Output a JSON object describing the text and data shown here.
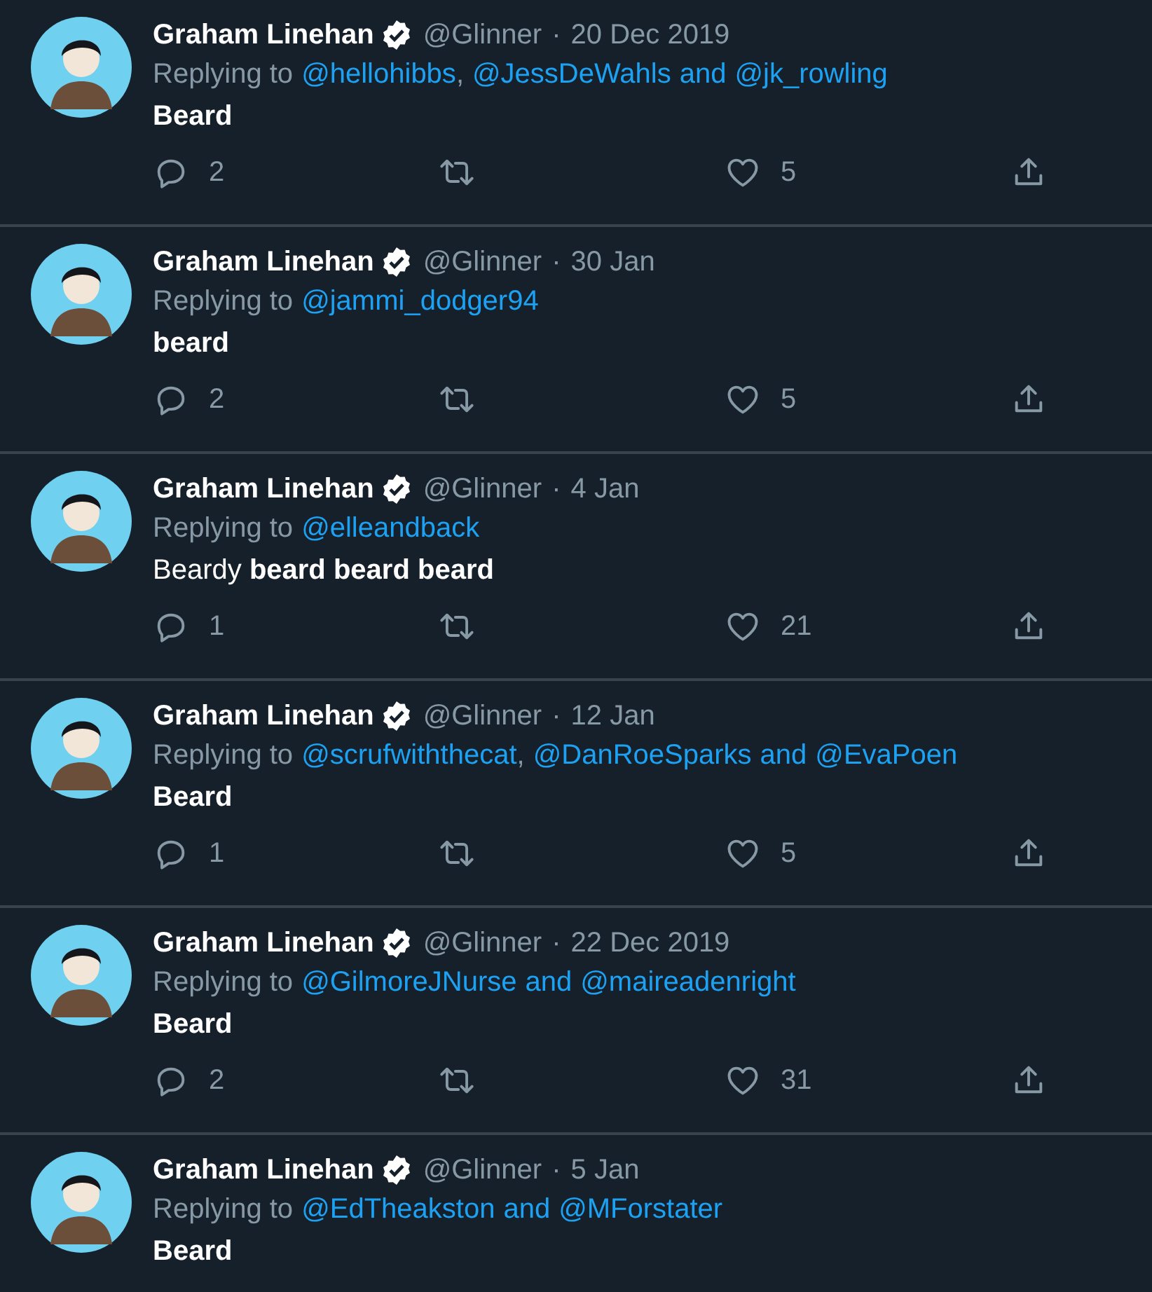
{
  "tweets": [
    {
      "name": "Graham Linehan",
      "verified": true,
      "handle": "@Glinner",
      "separator": "·",
      "date": "20 Dec 2019",
      "reply_label": "Replying to",
      "reply_parts": [
        {
          "kind": "mention",
          "text": "@hellohibbs"
        },
        {
          "kind": "separator",
          "text": ","
        },
        {
          "kind": "mention",
          "text": "@JessDeWahls"
        },
        {
          "kind": "conjunction",
          "text": "and"
        },
        {
          "kind": "mention",
          "text": "@jk_rowling"
        }
      ],
      "text": "Beard",
      "text_bold": true,
      "actions": [
        {
          "kind": "reply",
          "count": "2"
        },
        {
          "kind": "retweet"
        },
        {
          "kind": "like",
          "count": "5"
        },
        {
          "kind": "share"
        }
      ]
    },
    {
      "name": "Graham Linehan",
      "verified": true,
      "handle": "@Glinner",
      "separator": "·",
      "date": "30 Jan",
      "reply_label": "Replying to",
      "reply_parts": [
        {
          "kind": "mention",
          "text": "@jammi_dodger94"
        }
      ],
      "text": "beard",
      "text_bold": true,
      "actions": [
        {
          "kind": "reply",
          "count": "2"
        },
        {
          "kind": "retweet"
        },
        {
          "kind": "like",
          "count": "5"
        },
        {
          "kind": "share"
        }
      ]
    },
    {
      "name": "Graham Linehan",
      "verified": true,
      "handle": "@Glinner",
      "separator": "·",
      "date": "4 Jan",
      "reply_label": "Replying to",
      "reply_parts": [
        {
          "kind": "mention",
          "text": "@elleandback"
        }
      ],
      "text": "Beardy **beard beard beard**",
      "text_bold": false,
      "actions": [
        {
          "kind": "reply",
          "count": "1"
        },
        {
          "kind": "retweet"
        },
        {
          "kind": "like",
          "count": "21"
        },
        {
          "kind": "share"
        }
      ]
    },
    {
      "name": "Graham Linehan",
      "verified": true,
      "handle": "@Glinner",
      "separator": "·",
      "date": "12 Jan",
      "reply_label": "Replying to",
      "reply_parts": [
        {
          "kind": "mention",
          "text": "@scrufwiththecat"
        },
        {
          "kind": "separator",
          "text": ","
        },
        {
          "kind": "mention",
          "text": "@DanRoeSparks"
        },
        {
          "kind": "conjunction",
          "text": "and"
        },
        {
          "kind": "mention",
          "text": "@EvaPoen"
        }
      ],
      "text": "Beard",
      "text_bold": true,
      "actions": [
        {
          "kind": "reply",
          "count": "1"
        },
        {
          "kind": "retweet"
        },
        {
          "kind": "like",
          "count": "5"
        },
        {
          "kind": "share"
        }
      ]
    },
    {
      "name": "Graham Linehan",
      "verified": true,
      "handle": "@Glinner",
      "separator": "·",
      "date": "22 Dec 2019",
      "reply_label": "Replying to",
      "reply_parts": [
        {
          "kind": "mention",
          "text": "@GilmoreJNurse"
        },
        {
          "kind": "conjunction",
          "text": "and"
        },
        {
          "kind": "mention",
          "text": "@maireadenright"
        }
      ],
      "text": "Beard",
      "text_bold": true,
      "actions": [
        {
          "kind": "reply",
          "count": "2"
        },
        {
          "kind": "retweet"
        },
        {
          "kind": "like",
          "count": "31"
        },
        {
          "kind": "share"
        }
      ]
    },
    {
      "name": "Graham Linehan",
      "verified": true,
      "handle": "@Glinner",
      "separator": "·",
      "date": "5 Jan",
      "reply_label": "Replying to",
      "reply_parts": [
        {
          "kind": "mention",
          "text": "@EdTheakston"
        },
        {
          "kind": "conjunction",
          "text": "and"
        },
        {
          "kind": "mention",
          "text": "@MForstater"
        }
      ],
      "text": "Beard",
      "text_bold": true
    }
  ]
}
